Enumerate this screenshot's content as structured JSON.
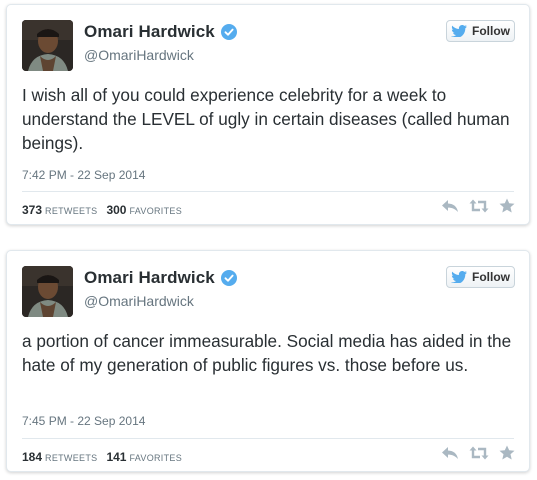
{
  "colors": {
    "name": "#292f33",
    "secondary": "#66757f",
    "verified": "#55acee",
    "bird": "#55acee",
    "action_icons": "#aab8c2",
    "border": "#e1e8ed"
  },
  "tweets": [
    {
      "author": {
        "name": "Omari Hardwick",
        "handle": "@OmariHardwick",
        "verified": true
      },
      "follow_label": "Follow",
      "text": "I wish all of you could experience celebrity for a week to understand the LEVEL of ugly in certain diseases (called human beings).",
      "timestamp": "7:42 PM - 22 Sep 2014",
      "retweets": "373",
      "retweets_label": "RETWEETS",
      "favorites": "300",
      "favorites_label": "FAVORITES",
      "icons": [
        "reply-icon",
        "retweet-icon",
        "favorite-star-icon"
      ]
    },
    {
      "author": {
        "name": "Omari Hardwick",
        "handle": "@OmariHardwick",
        "verified": true
      },
      "follow_label": "Follow",
      "text": "a portion of cancer immeasurable. Social media has aided in the hate of my generation of public figures vs. those before us.",
      "timestamp": "7:45 PM - 22 Sep 2014",
      "retweets": "184",
      "retweets_label": "RETWEETS",
      "favorites": "141",
      "favorites_label": "FAVORITES",
      "icons": [
        "reply-icon",
        "retweet-icon",
        "favorite-star-icon"
      ]
    }
  ]
}
